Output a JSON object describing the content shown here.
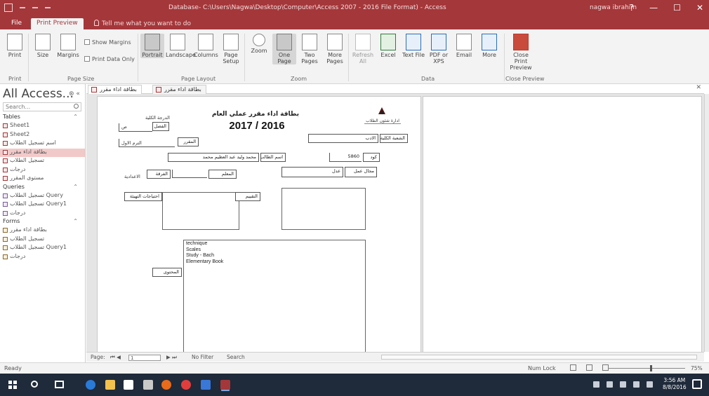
{
  "titlebar": {
    "title": "Database- C:\\Users\\Nagwa\\Desktop\\Computer\\Access 2007 - 2016 File Format) - Access",
    "user": "nagwa ibrahim",
    "win_help": "?",
    "win_min": "—",
    "win_max": "☐",
    "win_close": "✕"
  },
  "ribbon_tabs": {
    "file": "File",
    "print_preview": "Print Preview",
    "tell_me": "Tell me what you want to do"
  },
  "ribbon": {
    "print": "Print",
    "size": "Size",
    "margins": "Margins",
    "show_margins": "Show Margins",
    "print_data_only": "Print Data Only",
    "portrait": "Portrait",
    "landscape": "Landscape",
    "columns": "Columns",
    "page_setup": "Page Setup",
    "zoom": "Zoom",
    "one_page": "One Page",
    "two_pages": "Two Pages",
    "more_pages": "More Pages",
    "refresh_all": "Refresh All",
    "excel": "Excel",
    "text_file": "Text File",
    "pdf_or_xps": "PDF or XPS",
    "email": "Email",
    "more": "More",
    "close_print_preview": "Close Print Preview",
    "groups": {
      "print": "Print",
      "page_size": "Page Size",
      "page_layout": "Page Layout",
      "zoom": "Zoom",
      "data": "Data",
      "close_preview": "Close Preview"
    }
  },
  "nav": {
    "title": "All Access...",
    "controls": "⊛ «",
    "search_placeholder": "Search...",
    "groups": {
      "tables": "Tables",
      "queries": "Queries",
      "forms": "Forms"
    },
    "tables": [
      "Sheet1",
      "Sheet2",
      "اسم تسجيل الطلاب",
      "بطاقة اداء مقرر",
      "تسجيل الطلاب",
      "درجات",
      "مستوى المقرر"
    ],
    "queries": [
      "تسجيل الطلاب Query",
      "تسجيل الطلاب Query1",
      "درجات"
    ],
    "forms": [
      "بطاقة اداء مقرر",
      "تسجيل الطلاب",
      "تسجيل الطلاب Query1",
      "درجات"
    ],
    "selected_table_index": 3
  },
  "object_tabs": [
    "بطاقة اداء مقرر",
    "بطاقة اداء مقرر"
  ],
  "report": {
    "title": "بطاقة اداء مقرر عملي العام",
    "year": "2017 / 2016",
    "logo_caption": "ادارة شئون الطلاب",
    "header_label_right": "الشعبة الكلية",
    "header_value_right": "الادب",
    "label_level": "الدرجة الكلية",
    "label_term": "الفصل",
    "term_value": "ص",
    "label_sub": "الترم الاول",
    "label_course": "المقرر",
    "label_student_name": "اسم الطالب",
    "student_name": "محمد وليد عبد العظيم محمد",
    "label_code": "كود",
    "code_value": "5860",
    "label_level2": "الفرقة",
    "level2_value": "الاعدادية",
    "label_teacher": "المعلم",
    "label_section": "مجال عمل",
    "section_value": "عدل",
    "label_notes": "احتياجات التهيئة",
    "label_eval": "التقييم",
    "label_content": "المحتوى",
    "content_lines": [
      "technique",
      "Scales",
      "Study - Bach",
      "Elementary Book"
    ]
  },
  "record_nav": {
    "label": "Page:",
    "page_value": "1",
    "filter": "No Filter",
    "search": "Search"
  },
  "status": {
    "ready": "Ready",
    "numlock": "Num Lock",
    "zoom_percent": "75%",
    "zoom_level": 0.55
  },
  "taskbar": {
    "time": "3:56 AM",
    "date": "8/8/2016"
  }
}
